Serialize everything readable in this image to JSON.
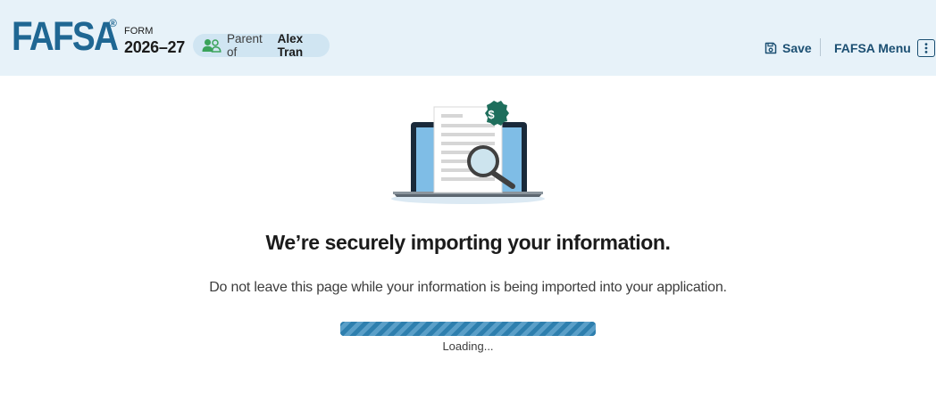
{
  "header": {
    "logo_text": "FAFSA",
    "logo_mark": "®",
    "form_label": "FORM",
    "form_year": "2026–27",
    "role": {
      "prefix": "Parent of",
      "name": "Alex Tran",
      "icon": "users-icon"
    },
    "save_label": "Save",
    "save_icon": "save-icon",
    "menu_label": "FAFSA Menu",
    "menu_icon": "kebab-icon"
  },
  "main": {
    "illustration_icon": "laptop-document-search-illustration",
    "heading": "We’re securely importing your information.",
    "subtext": "Do not leave this page while your information is being imported into your application.",
    "progress": {
      "value": 1.0,
      "label": "Loading..."
    }
  },
  "colors": {
    "header_bg": "#e7f2f9",
    "brand": "#1f6793",
    "accent_green": "#1e6e5c",
    "progress_fill": "#2e7fae"
  }
}
